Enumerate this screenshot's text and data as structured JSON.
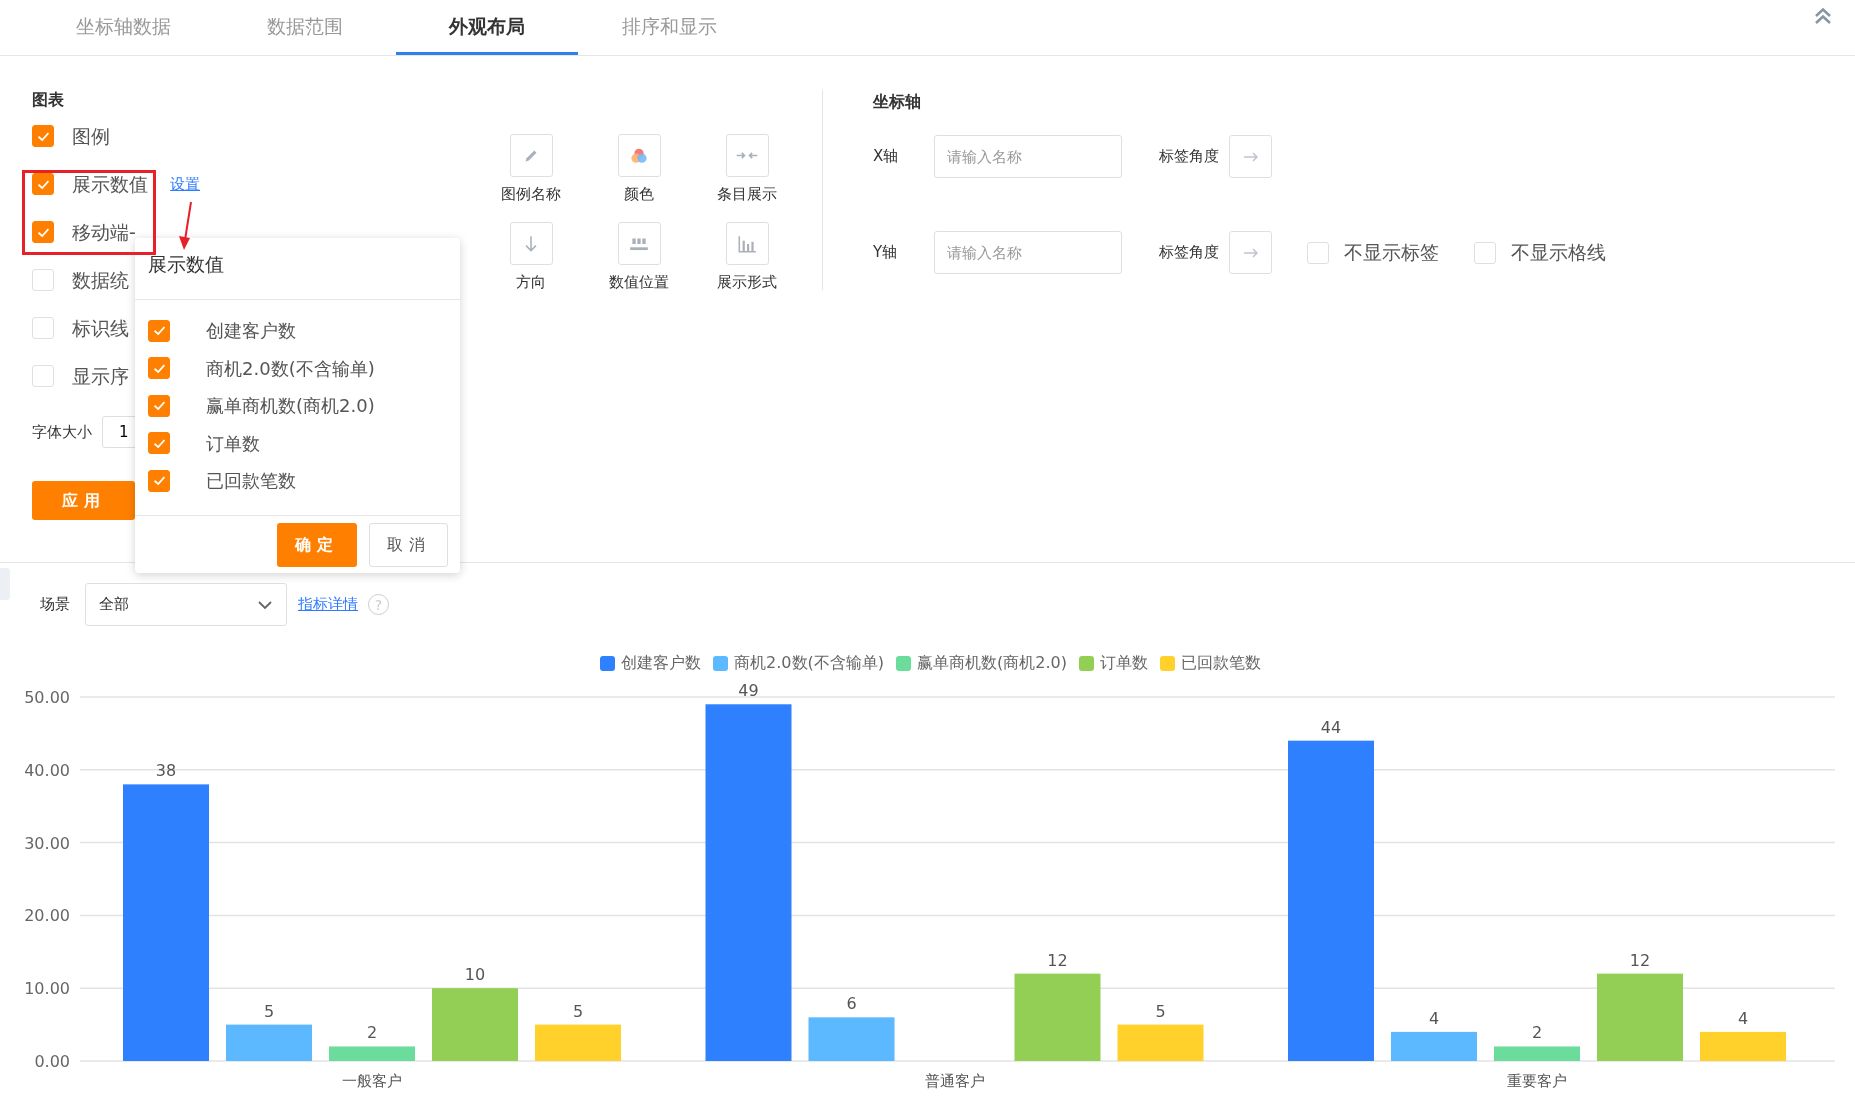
{
  "tabs": [
    {
      "label": "坐标轴数据",
      "selected": false
    },
    {
      "label": "数据范围",
      "selected": false
    },
    {
      "label": "外观布局",
      "selected": true
    },
    {
      "label": "排序和显示",
      "selected": false
    }
  ],
  "chart_settings": {
    "title": "图表",
    "options": [
      {
        "label": "图例",
        "checked": true
      },
      {
        "label": "展示数值",
        "checked": true,
        "link": "设置"
      },
      {
        "label": "移动端-",
        "checked": true
      },
      {
        "label": "数据统",
        "checked": false
      },
      {
        "label": "标识线",
        "checked": false
      },
      {
        "label": "显示序",
        "checked": false
      }
    ],
    "font_size": {
      "label": "字体大小",
      "value": "1"
    },
    "apply_button": "应用"
  },
  "style_tools": [
    {
      "label": "图例名称",
      "kind": "pencil"
    },
    {
      "label": "颜色",
      "kind": "palette"
    },
    {
      "label": "条目展示",
      "kind": "compress"
    },
    {
      "label": "方向",
      "kind": "arrow-down"
    },
    {
      "label": "数值位置",
      "kind": "value-position"
    },
    {
      "label": "展示形式",
      "kind": "bar-chart"
    }
  ],
  "popover": {
    "title": "展示数值",
    "items": [
      {
        "label": "创建客户数",
        "checked": true
      },
      {
        "label": "商机2.0数(不含输单)",
        "checked": true
      },
      {
        "label": "赢单商机数(商机2.0)",
        "checked": true
      },
      {
        "label": "订单数",
        "checked": true
      },
      {
        "label": "已回款笔数",
        "checked": true
      }
    ],
    "buttons": [
      "确定",
      "取消"
    ]
  },
  "axis": {
    "title": "坐标轴",
    "rows": [
      {
        "label": "X轴",
        "placeholder": "请输入名称",
        "angle_label": "标签角度",
        "options": []
      },
      {
        "label": "Y轴",
        "placeholder": "请输入名称",
        "angle_label": "标签角度",
        "options": [
          {
            "label": "不显示标签",
            "checked": false
          },
          {
            "label": "不显示格线",
            "checked": false
          }
        ]
      }
    ]
  },
  "scene": {
    "label": "场景",
    "value": "全部",
    "link": "指标详情",
    "help": "?"
  },
  "chart_data": {
    "type": "bar",
    "categories": [
      "一般客户",
      "普通客户",
      "重要客户"
    ],
    "series": [
      {
        "name": "创建客户数",
        "color": "#2f80ff",
        "values": [
          38,
          49,
          44
        ]
      },
      {
        "name": "商机2.0数(不含输单)",
        "color": "#5cb8ff",
        "values": [
          5,
          6,
          4
        ]
      },
      {
        "name": "赢单商机数(商机2.0)",
        "color": "#6cdc9c",
        "values": [
          2,
          null,
          2
        ]
      },
      {
        "name": "订单数",
        "color": "#93cf55",
        "values": [
          10,
          12,
          12
        ]
      },
      {
        "name": "已回款笔数",
        "color": "#ffd12a",
        "values": [
          5,
          5,
          4
        ]
      }
    ],
    "ylim": [
      0,
      50
    ],
    "yticks": [
      {
        "value": 0,
        "label": "0.00"
      },
      {
        "value": 10,
        "label": "10.00"
      },
      {
        "value": 20,
        "label": "20.00"
      },
      {
        "value": 30,
        "label": "30.00"
      },
      {
        "value": 40,
        "label": "40.00"
      },
      {
        "value": 50,
        "label": "50.00"
      }
    ],
    "grid": true,
    "data_labels": true
  }
}
